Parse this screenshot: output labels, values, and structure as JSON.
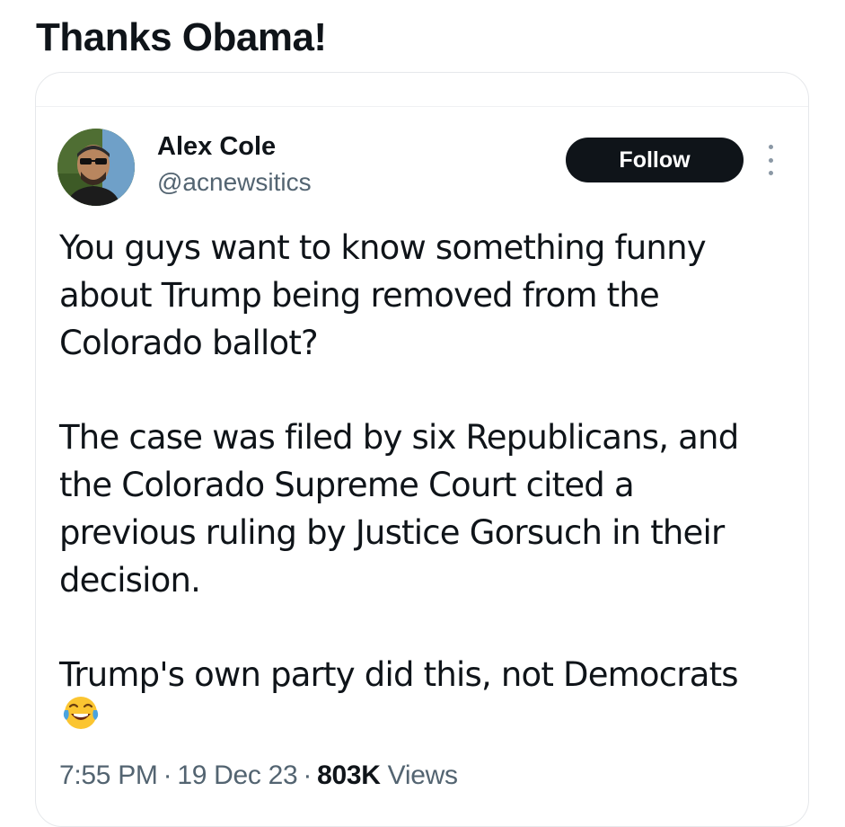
{
  "post": {
    "title": "Thanks Obama!"
  },
  "tweet": {
    "author": {
      "name": "Alex Cole",
      "handle": "@acnewsitics"
    },
    "follow_label": "Follow",
    "text": {
      "paragraph_1": "You guys want to know something funny about Trump being removed from the Colorado ballot?",
      "paragraph_2": "The case was filed by six Republicans, and the Colorado Supreme Court cited a previous ruling by Justice Gorsuch in their decision.",
      "paragraph_3": "Trump's own party did this, not Democrats"
    },
    "emoji": "face-with-tears-of-joy-icon",
    "meta": {
      "time": "7:55 PM",
      "separator": "·",
      "date": "19 Dec 23",
      "views_count": "803K",
      "views_label": "Views"
    }
  },
  "colors": {
    "text_primary": "#0f1419",
    "text_secondary": "#536471",
    "follow_bg": "#0f1419",
    "follow_text": "#ffffff",
    "card_border": "#e6e8eb"
  }
}
